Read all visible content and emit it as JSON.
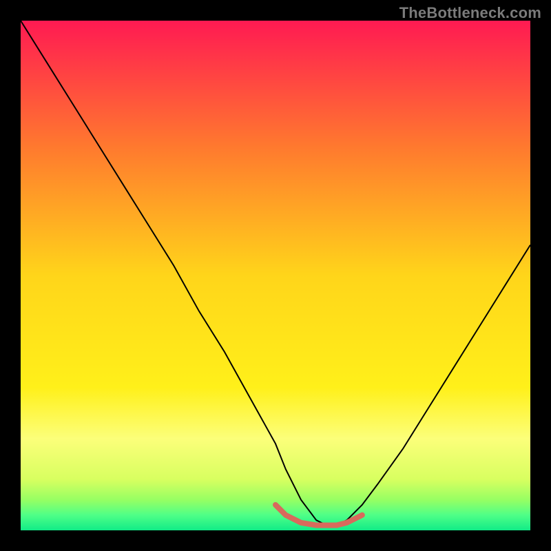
{
  "watermark": "TheBottleneck.com",
  "chart_data": {
    "type": "line",
    "title": "",
    "xlabel": "",
    "ylabel": "",
    "xlim": [
      0,
      100
    ],
    "ylim": [
      0,
      100
    ],
    "grid": false,
    "legend": false,
    "gradient_stops": [
      {
        "pos": 0.0,
        "color": "#ff1a52"
      },
      {
        "pos": 0.25,
        "color": "#ff7a2e"
      },
      {
        "pos": 0.5,
        "color": "#ffd51a"
      },
      {
        "pos": 0.72,
        "color": "#fff01a"
      },
      {
        "pos": 0.82,
        "color": "#fcff7a"
      },
      {
        "pos": 0.9,
        "color": "#d8ff60"
      },
      {
        "pos": 0.94,
        "color": "#97ff63"
      },
      {
        "pos": 0.97,
        "color": "#4fff87"
      },
      {
        "pos": 1.0,
        "color": "#11eb87"
      }
    ],
    "series": [
      {
        "name": "curve",
        "stroke": "#000000",
        "stroke_width": 2,
        "x": [
          0,
          5,
          10,
          15,
          20,
          25,
          30,
          35,
          40,
          45,
          50,
          52,
          55,
          58,
          60,
          62,
          64,
          67,
          70,
          75,
          80,
          85,
          90,
          95,
          100
        ],
        "values": [
          100,
          92,
          84,
          76,
          68,
          60,
          52,
          43,
          35,
          26,
          17,
          12,
          6,
          2,
          1,
          1,
          2,
          5,
          9,
          16,
          24,
          32,
          40,
          48,
          56
        ]
      },
      {
        "name": "highlight-band",
        "stroke": "#d86a5c",
        "stroke_width": 8,
        "x": [
          50,
          52,
          55,
          58,
          60,
          62,
          64,
          67
        ],
        "values": [
          5,
          3,
          1.5,
          1,
          1,
          1,
          1.5,
          3
        ]
      }
    ]
  }
}
